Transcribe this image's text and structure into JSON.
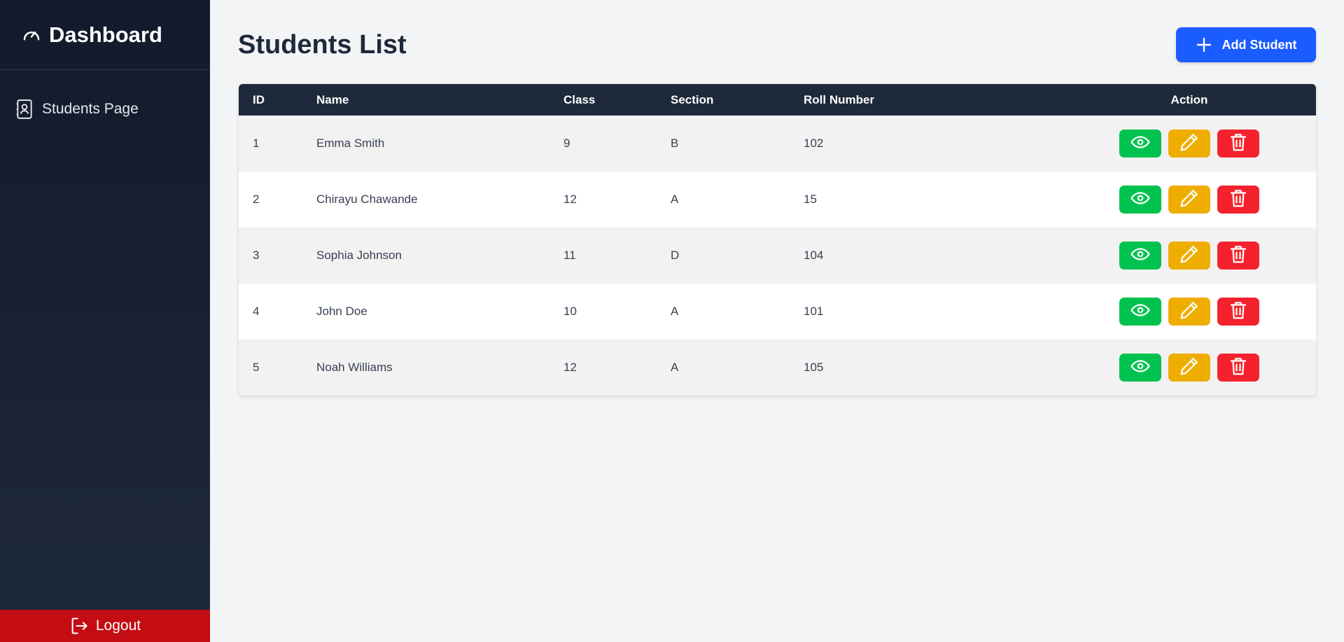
{
  "sidebar": {
    "brand": {
      "title": "Dashboard",
      "icon": "gauge-icon"
    },
    "items": [
      {
        "label": "Students Page",
        "icon": "contact-book-icon"
      }
    ],
    "logout": {
      "label": "Logout",
      "icon": "logout-icon",
      "color": "#c30d12"
    }
  },
  "main": {
    "title": "Students List",
    "add_button": {
      "label": "Add Student",
      "icon": "plus-icon",
      "color": "#1a5cff"
    },
    "table": {
      "headers": {
        "id": "ID",
        "name": "Name",
        "class": "Class",
        "section": "Section",
        "roll": "Roll Number",
        "action": "Action"
      },
      "rows": [
        {
          "id": "1",
          "name": "Emma Smith",
          "class": "9",
          "section": "B",
          "roll": "102"
        },
        {
          "id": "2",
          "name": "Chirayu Chawande",
          "class": "12",
          "section": "A",
          "roll": "15"
        },
        {
          "id": "3",
          "name": "Sophia Johnson",
          "class": "11",
          "section": "D",
          "roll": "104"
        },
        {
          "id": "4",
          "name": "John Doe",
          "class": "10",
          "section": "A",
          "roll": "101"
        },
        {
          "id": "5",
          "name": "Noah Williams",
          "class": "12",
          "section": "A",
          "roll": "105"
        }
      ],
      "action_icons": {
        "view": "eye-icon",
        "edit": "pencil-icon",
        "delete": "trash-icon"
      },
      "action_colors": {
        "view": "#00c24f",
        "edit": "#efad00",
        "delete": "#f5222d"
      }
    }
  }
}
